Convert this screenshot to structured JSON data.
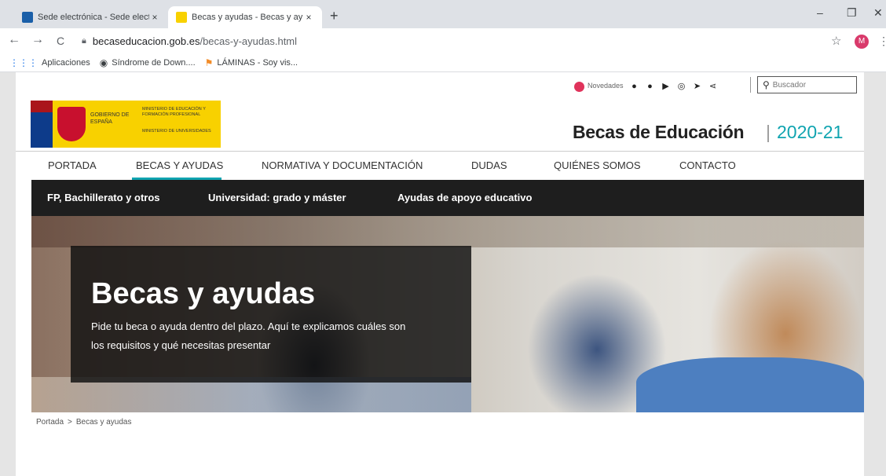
{
  "browser": {
    "tabs": [
      {
        "title": "Sede electrónica - Sede electrón",
        "favicon_color": "#1a5fa8"
      },
      {
        "title": "Becas y ayudas - Becas y ayudas",
        "favicon_color": "#f8d100"
      }
    ],
    "close_glyph": "×",
    "newtab_glyph": "+",
    "window_controls": {
      "minimize": "–",
      "restore": "❐",
      "close": "✕"
    },
    "nav": {
      "back": "←",
      "forward": "→",
      "reload": "C"
    },
    "url_host": "becaseducacion.gob.es",
    "url_path": "/becas-y-ayudas.html",
    "profile_initial": "M",
    "bookmarks": [
      {
        "label": "Aplicaciones",
        "icon": "apps-grid-icon"
      },
      {
        "label": "Síndrome de Down....",
        "icon": "globe-icon"
      },
      {
        "label": "LÁMINAS - Soy vis...",
        "icon": "bookmark-flag-icon"
      }
    ]
  },
  "site": {
    "novedades": "Novedades",
    "search_placeholder": "Buscador",
    "logo": {
      "gobierno": "GOBIERNO DE ESPAÑA",
      "ministerio1": "MINISTERIO DE EDUCACIÓN Y FORMACIÓN PROFESIONAL",
      "ministerio2": "MINISTERIO DE UNIVERSIDADES"
    },
    "title": "Becas de Educación",
    "year_sep": "|",
    "year": "2020-21",
    "main_nav": [
      "PORTADA",
      "BECAS Y AYUDAS",
      "NORMATIVA Y DOCUMENTACIÓN",
      "DUDAS",
      "QUIÉNES SOMOS",
      "CONTACTO"
    ],
    "main_nav_active": "BECAS Y AYUDAS",
    "sub_nav": [
      "FP, Bachillerato y otros",
      "Universidad: grado y máster",
      "Ayudas de apoyo educativo"
    ],
    "hero": {
      "title": "Becas y ayudas",
      "text": "Pide tu beca o ayuda dentro del plazo. Aquí te explicamos cuáles son los requisitos y qué necesitas presentar"
    },
    "breadcrumb": {
      "home": "Portada",
      "separator": ">",
      "current": "Becas y ayudas"
    },
    "colors": {
      "accent": "#10a4b0",
      "logo_yellow": "#f8d100",
      "subnav_bg": "#1e1e1e"
    }
  }
}
